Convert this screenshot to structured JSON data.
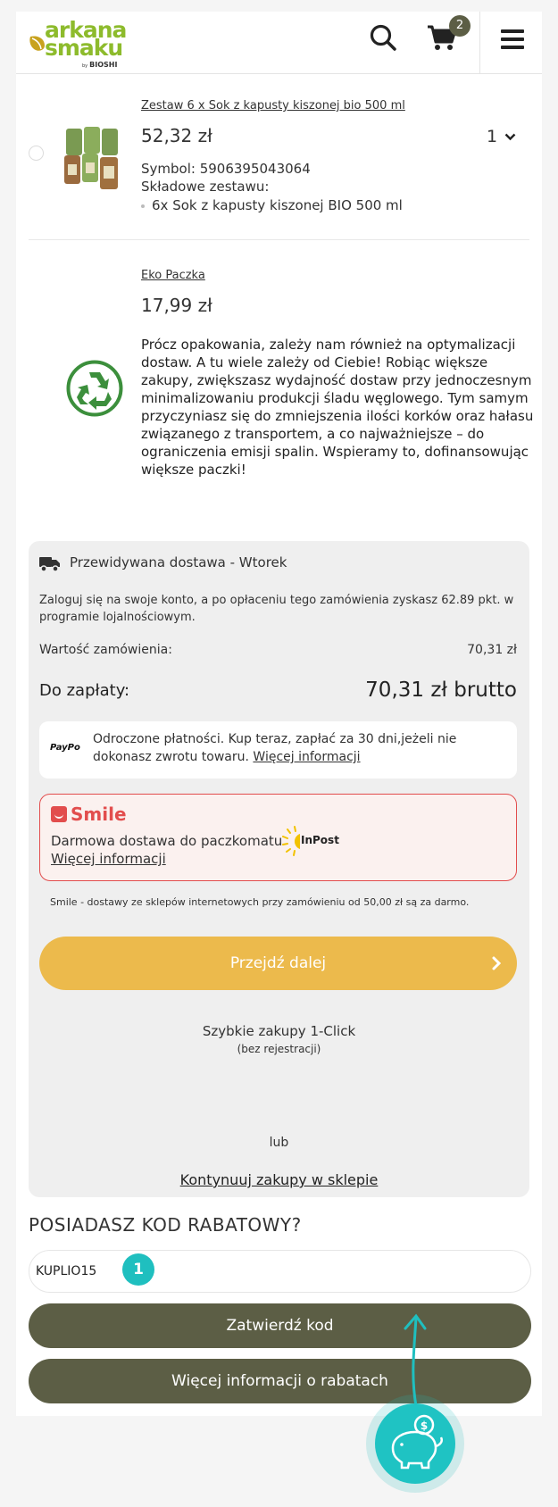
{
  "header": {
    "logo_line1": "arkana",
    "logo_line2": "smaku",
    "logo_by": "by",
    "logo_brand": "BIOSHI",
    "cart_count": "2"
  },
  "product": {
    "title": "Zestaw 6 x Sok z kapusty kiszonej bio 500 ml",
    "price": "52,32 zł",
    "quantity": "1",
    "symbol": "Symbol: 5906395043064",
    "components_label": "Składowe zestawu:",
    "component_item": "6x Sok z kapusty kiszonej BIO 500 ml"
  },
  "eko": {
    "title": "Eko Paczka",
    "price": "17,99 zł",
    "description": "Prócz opakowania, zależy nam również na optymalizacji dostaw. A tu wiele zależy od Ciebie! Robiąc większe zakupy, zwiększasz wydajność dostaw przy jednoczesnym minimalizowaniu produkcji śladu węglowego. Tym samym przyczyniasz się do zmniejszenia ilości korków oraz hałasu związanego z transportem, a co najważniejsze – do ograniczenia emisji spalin. Wspieramy to, dofinansowując większe paczki!"
  },
  "summary": {
    "delivery": "Przewidywana dostawa - Wtorek",
    "loyalty": "Zaloguj się na swoje konto, a po opłaceniu tego zamówienia zyskasz 62.89 pkt. w programie lojalnościowym.",
    "order_value_label": "Wartość zamówienia:",
    "order_value": "70,31 zł",
    "to_pay_label": "Do zapłaty:",
    "to_pay_value": "70,31 zł brutto",
    "paypo_logo": "PayPo",
    "paypo_text": "Odroczone płatności. Kup teraz, zapłać za 30 dni,jeżeli nie dokonasz zwrotu towaru.",
    "paypo_link": "Więcej informacji",
    "smile_logo": "Smile",
    "smile_line": "Darmowa dostawa do paczkomatu",
    "inpost_logo": "InPost",
    "smile_link": "Więcej informacji",
    "smile_note": "Smile - dostawy ze sklepów internetowych przy zamówieniu od 50,00 zł są za darmo.",
    "next_button": "Przejdź dalej",
    "oneclick": "Szybkie zakupy 1-Click",
    "oneclick_sub": "(bez rejestracji)",
    "or": "lub",
    "continue_link": "Kontynuuj zakupy w sklepie"
  },
  "discount": {
    "title": "POSIADASZ KOD RABATOWY?",
    "code_value": "KUPLIO15",
    "step_badge": "1",
    "apply_button": "Zatwierdź kod",
    "more_button": "Więcej informacji o rabatach"
  },
  "colors": {
    "accent_dark": "#5c5e45",
    "accent_yellow": "#ecba4c",
    "brand_green": "#8dbb2c",
    "smile_red": "#e24d4d",
    "overlay_teal": "#1fbfbf"
  }
}
